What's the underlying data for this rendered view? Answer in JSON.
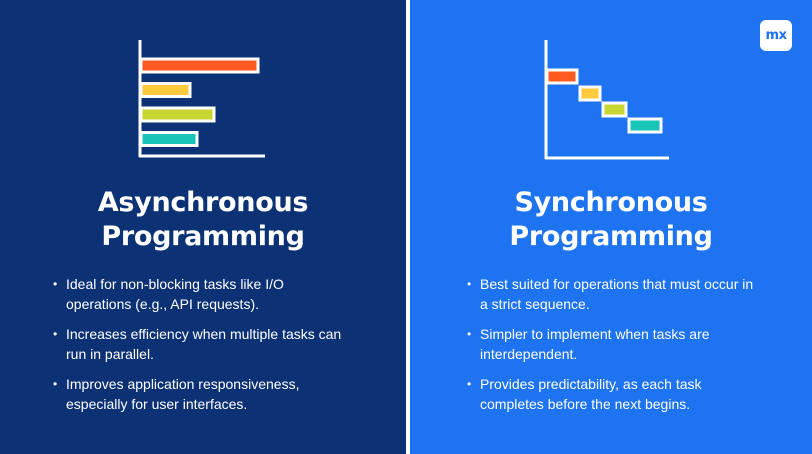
{
  "left_panel": {
    "title_line1": "Asynchronous",
    "title_line2": "Programming",
    "bullets": [
      "Ideal for non-blocking tasks like I/O operations (e.g., API requests).",
      "Increases efficiency when multiple tasks can run in parallel.",
      "Improves application responsiveness, especially for user interfaces."
    ],
    "illustration": {
      "type": "parallel-bars",
      "bar_colors": [
        "#ff5a1f",
        "#ffcb3d",
        "#c8d631",
        "#18c3b8"
      ],
      "bar_lengths": [
        1.0,
        0.42,
        0.62,
        0.48
      ]
    }
  },
  "right_panel": {
    "title_line1": "Synchronous",
    "title_line2": "Programming",
    "bullets": [
      "Best suited for operations that must occur in a strict sequence.",
      "Simpler to implement when tasks are interdependent.",
      "Provides predictability, as each task completes before the next begins."
    ],
    "illustration": {
      "type": "sequential-steps",
      "bar_colors": [
        "#ff5a1f",
        "#ffcb3d",
        "#c8d631",
        "#18c3b8"
      ]
    }
  },
  "logo": {
    "text": "mx",
    "icon": "mendix-logo-icon"
  },
  "colors": {
    "left_bg": "#0c3275",
    "right_bg": "#1d73f0",
    "text": "#ffffff"
  }
}
